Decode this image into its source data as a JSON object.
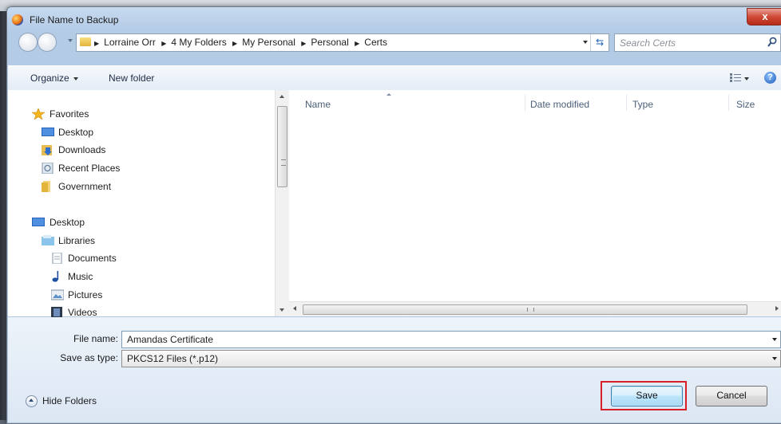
{
  "window": {
    "title": "File Name to Backup",
    "close_label": "x"
  },
  "address": {
    "crumbs": [
      "Lorraine Orr",
      "4 My Folders",
      "My Personal",
      "Personal",
      "Certs"
    ],
    "search_placeholder": "Search Certs"
  },
  "toolbar": {
    "organize": "Organize",
    "new_folder": "New folder",
    "help": "?"
  },
  "nav": {
    "favorites_label": "Favorites",
    "favorites": [
      "Desktop",
      "Downloads",
      "Recent Places",
      "Government"
    ],
    "desktop_label": "Desktop",
    "libraries_label": "Libraries",
    "libraries": [
      "Documents",
      "Music",
      "Pictures",
      "Videos"
    ]
  },
  "columns": [
    "Name",
    "Date modified",
    "Type",
    "Size"
  ],
  "form": {
    "file_name_label": "File name:",
    "file_name_value": "Amandas Certificate",
    "save_type_label": "Save as type:",
    "save_type_value": "PKCS12 Files (*.p12)"
  },
  "footer": {
    "hide_folders": "Hide Folders",
    "save": "Save",
    "cancel": "Cancel"
  },
  "colors": {
    "accent": "#d61f26",
    "folder": "#e3b43b"
  }
}
